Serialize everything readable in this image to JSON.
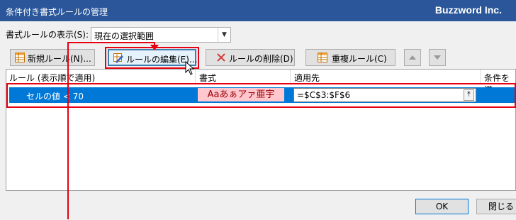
{
  "window": {
    "title": "条件付き書式ルールの管理",
    "watermark": "Buzzword Inc."
  },
  "show_rules": {
    "label": "書式ルールの表示(S):",
    "value": "現在の選択範囲"
  },
  "toolbar": {
    "new_rule": "新規ルール(N)...",
    "edit_rule": "ルールの編集(E)...",
    "delete_rule": "ルールの削除(D)",
    "duplicate_rule": "重複ルール(C)"
  },
  "columns": [
    "ルール (表示順で適用)",
    "書式",
    "適用先",
    "条件を満"
  ],
  "rules": [
    {
      "condition": "セルの値 < 70",
      "format_preview": "Aaあぁアァ亜宇",
      "applies_to": "=$C$3:$F$6"
    }
  ],
  "buttons": {
    "ok": "OK",
    "close": "閉じる"
  },
  "colors": {
    "titlebar": "#2b579a",
    "selection": "#0078d7",
    "preview_fill": "#ffc7ce",
    "preview_text": "#9c0006",
    "annotation": "#e60012"
  }
}
